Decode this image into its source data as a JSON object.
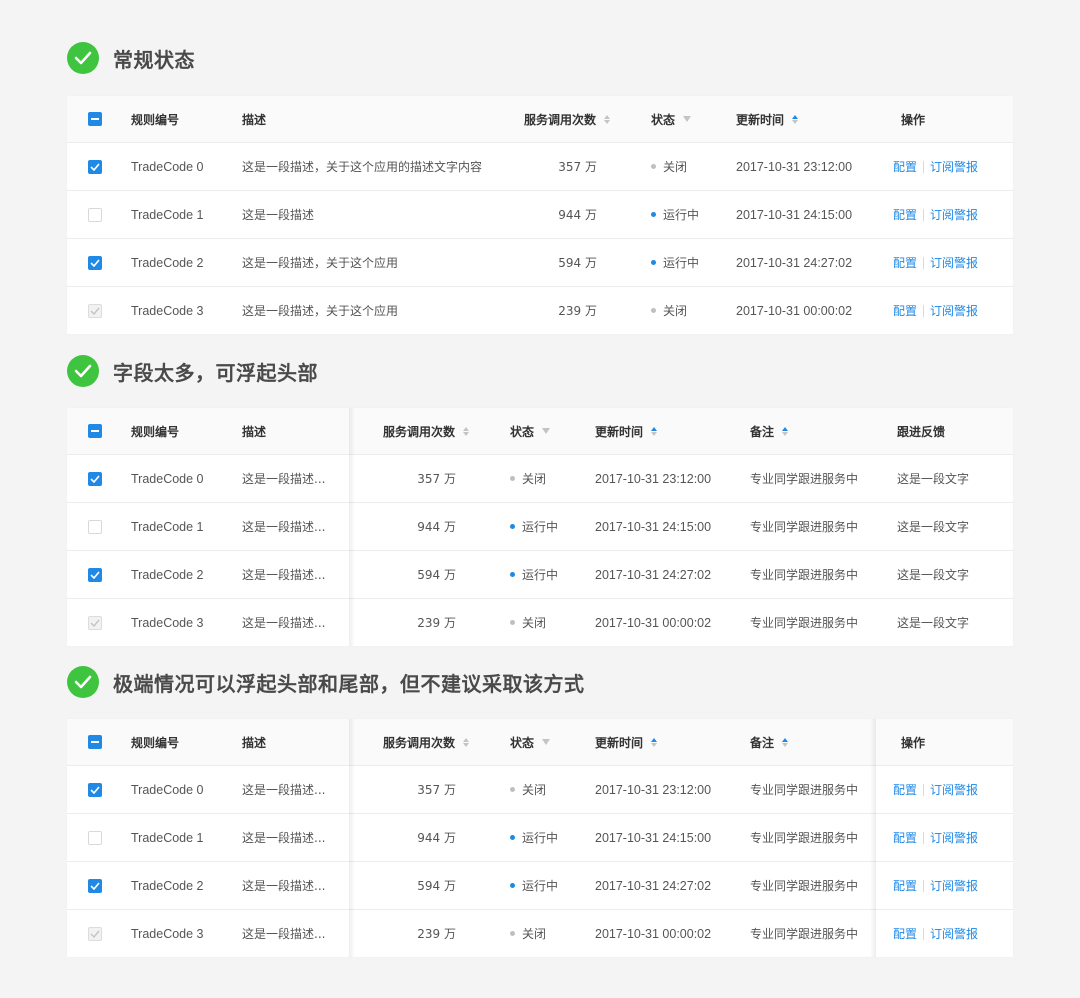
{
  "colors": {
    "accent": "#1f89e5",
    "success": "#3fc43f",
    "muted_dot": "#bfbfbf"
  },
  "sections": [
    {
      "title": "常规状态",
      "headers": {
        "code": "规则编号",
        "desc": "描述",
        "calls": "服务调用次数",
        "status": "状态",
        "time": "更新时间",
        "action": "操作"
      },
      "rows": [
        {
          "checkbox": "checked",
          "code": "TradeCode 0",
          "desc": "这是一段描述，关于这个应用的描述文字内容",
          "calls": "357 万",
          "status": "关闭",
          "status_kind": "off",
          "time": "2017-10-31  23:12:00",
          "config": "配置",
          "subscribe": "订阅警报"
        },
        {
          "checkbox": "unchecked",
          "code": "TradeCode 1",
          "desc": "这是一段描述",
          "calls": "944 万",
          "status": "运行中",
          "status_kind": "run",
          "time": "2017-10-31  24:15:00",
          "config": "配置",
          "subscribe": "订阅警报"
        },
        {
          "checkbox": "checked",
          "code": "TradeCode 2",
          "desc": "这是一段描述，关于这个应用",
          "calls": "594 万",
          "status": "运行中",
          "status_kind": "run",
          "time": "2017-10-31  24:27:02",
          "config": "配置",
          "subscribe": "订阅警报"
        },
        {
          "checkbox": "disabled",
          "code": "TradeCode 3",
          "desc": "这是一段描述，关于这个应用",
          "calls": "239 万",
          "status": "关闭",
          "status_kind": "off",
          "time": "2017-10-31  00:00:02",
          "config": "配置",
          "subscribe": "订阅警报"
        }
      ]
    },
    {
      "title": "字段太多，可浮起头部",
      "headers": {
        "code": "规则编号",
        "desc": "描述",
        "calls": "服务调用次数",
        "status": "状态",
        "time": "更新时间",
        "note": "备注",
        "feedback": "跟进反馈"
      },
      "rows": [
        {
          "checkbox": "checked",
          "code": "TradeCode 0",
          "desc": "这是一段描述...",
          "calls": "357 万",
          "status": "关闭",
          "status_kind": "off",
          "time": "2017-10-31  23:12:00",
          "note": "专业同学跟进服务中",
          "feedback": "这是一段文字"
        },
        {
          "checkbox": "unchecked",
          "code": "TradeCode 1",
          "desc": "这是一段描述...",
          "calls": "944 万",
          "status": "运行中",
          "status_kind": "run",
          "time": "2017-10-31  24:15:00",
          "note": "专业同学跟进服务中",
          "feedback": "这是一段文字"
        },
        {
          "checkbox": "checked",
          "code": "TradeCode 2",
          "desc": "这是一段描述...",
          "calls": "594 万",
          "status": "运行中",
          "status_kind": "run",
          "time": "2017-10-31  24:27:02",
          "note": "专业同学跟进服务中",
          "feedback": "这是一段文字"
        },
        {
          "checkbox": "disabled",
          "code": "TradeCode 3",
          "desc": "这是一段描述...",
          "calls": "239 万",
          "status": "关闭",
          "status_kind": "off",
          "time": "2017-10-31  00:00:02",
          "note": "专业同学跟进服务中",
          "feedback": "这是一段文字"
        }
      ]
    },
    {
      "title": "极端情况可以浮起头部和尾部，但不建议采取该方式",
      "headers": {
        "code": "规则编号",
        "desc": "描述",
        "calls": "服务调用次数",
        "status": "状态",
        "time": "更新时间",
        "note": "备注",
        "action": "操作"
      },
      "rows": [
        {
          "checkbox": "checked",
          "code": "TradeCode 0",
          "desc": "这是一段描述...",
          "calls": "357 万",
          "status": "关闭",
          "status_kind": "off",
          "time": "2017-10-31  23:12:00",
          "note": "专业同学跟进服务中",
          "config": "配置",
          "subscribe": "订阅警报"
        },
        {
          "checkbox": "unchecked",
          "code": "TradeCode 1",
          "desc": "这是一段描述...",
          "calls": "944 万",
          "status": "运行中",
          "status_kind": "run",
          "time": "2017-10-31  24:15:00",
          "note": "专业同学跟进服务中",
          "config": "配置",
          "subscribe": "订阅警报"
        },
        {
          "checkbox": "checked",
          "code": "TradeCode 2",
          "desc": "这是一段描述...",
          "calls": "594 万",
          "status": "运行中",
          "status_kind": "run",
          "time": "2017-10-31  24:27:02",
          "note": "专业同学跟进服务中",
          "config": "配置",
          "subscribe": "订阅警报"
        },
        {
          "checkbox": "disabled",
          "code": "TradeCode 3",
          "desc": "这是一段描述...",
          "calls": "239 万",
          "status": "关闭",
          "status_kind": "off",
          "time": "2017-10-31  00:00:02",
          "note": "专业同学跟进服务中",
          "config": "配置",
          "subscribe": "订阅警报"
        }
      ]
    }
  ]
}
